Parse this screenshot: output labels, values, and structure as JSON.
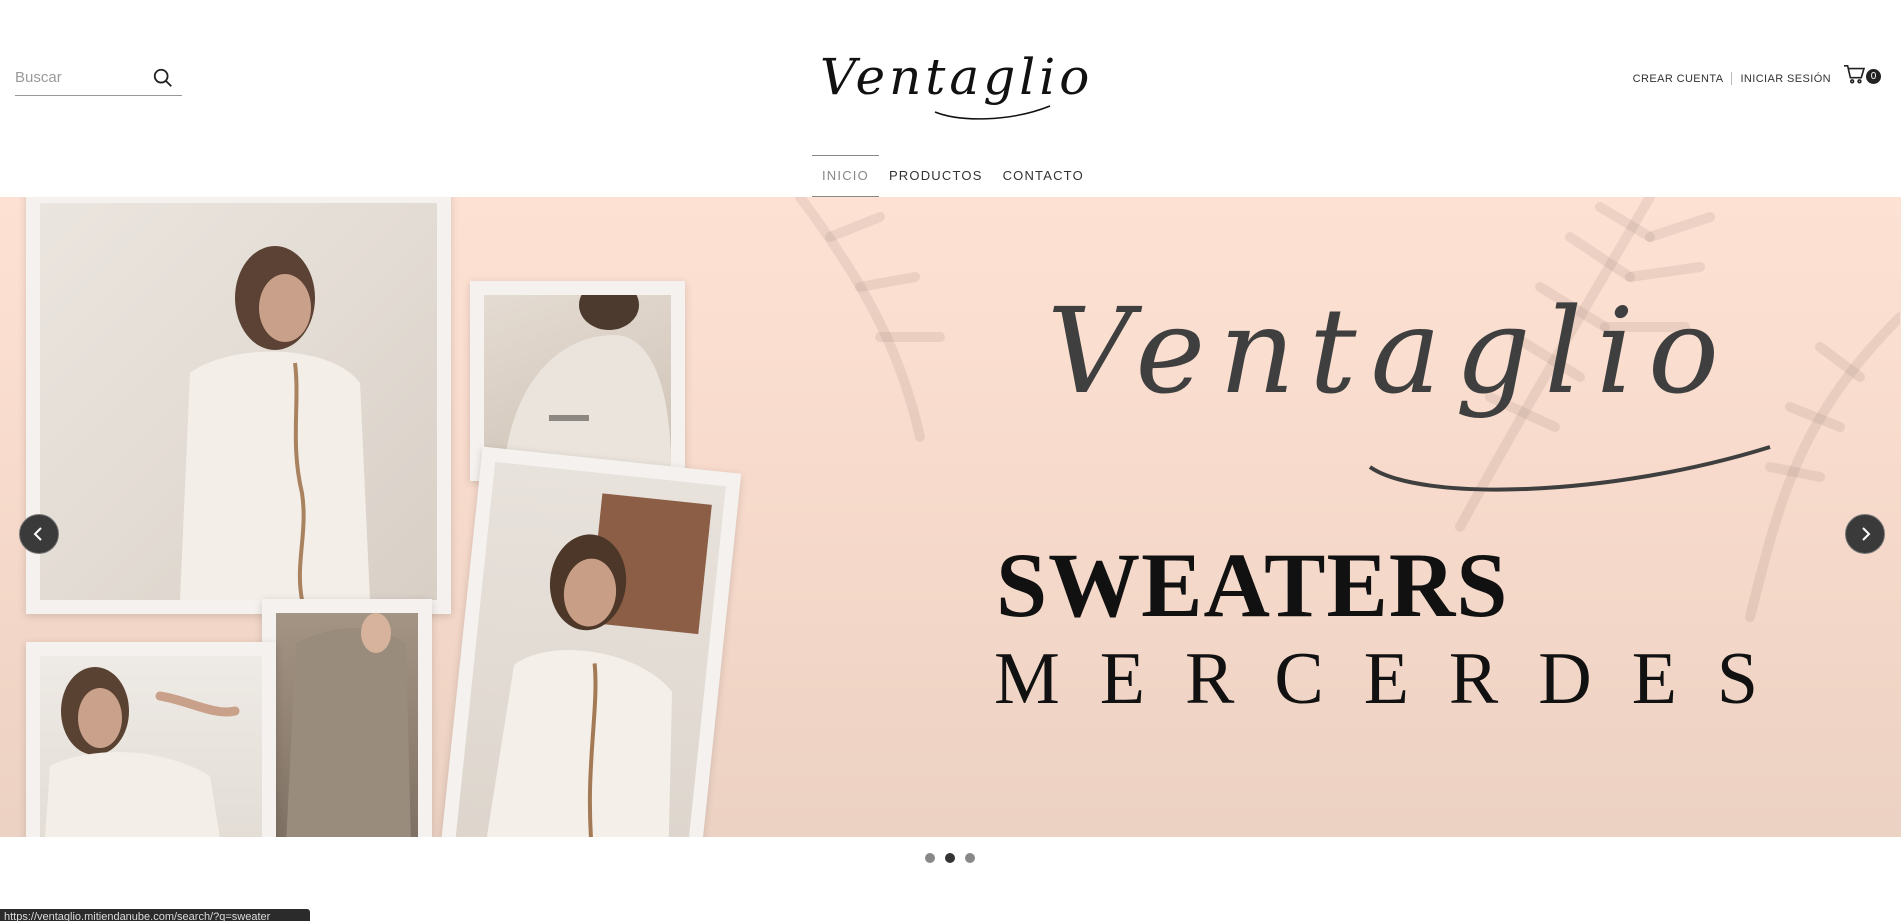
{
  "header": {
    "search_placeholder": "Buscar",
    "logo_text": "Ventaglio",
    "account": {
      "create": "CREAR CUENTA",
      "login": "INICIAR SESIÓN"
    },
    "cart_count": "0"
  },
  "nav": {
    "items": [
      "INICIO",
      "PRODUCTOS",
      "CONTACTO"
    ],
    "active": "INICIO"
  },
  "slider": {
    "brand": "Ventaglio",
    "headline": "SWEATERS",
    "subline": "MERCERDES",
    "dot_count": 3,
    "active_dot": 2
  },
  "status_bar": {
    "url": "https://ventaglio.mitiendanube.com/search/?q=sweater"
  },
  "colors": {
    "accent": "#333333",
    "banner_bg": "#fde2d4",
    "text": "#111111"
  }
}
